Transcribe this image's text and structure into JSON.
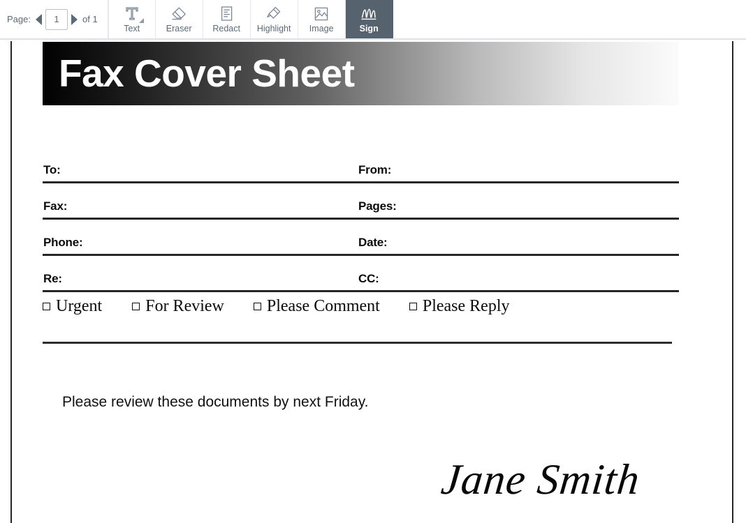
{
  "toolbar": {
    "page_nav": {
      "label": "Page:",
      "prev_icon": "triangle-left-icon",
      "current_page": "1",
      "next_icon": "triangle-right-icon",
      "total_label": "of 1"
    },
    "tools": [
      {
        "id": "text",
        "label": "Text",
        "icon": "text-tool-icon",
        "active": false,
        "has_dropdown": true
      },
      {
        "id": "eraser",
        "label": "Eraser",
        "icon": "eraser-icon",
        "active": false,
        "has_dropdown": false
      },
      {
        "id": "redact",
        "label": "Redact",
        "icon": "redact-document-icon",
        "active": false,
        "has_dropdown": false
      },
      {
        "id": "highlight",
        "label": "Highlight",
        "icon": "highlighter-pen-icon",
        "active": false,
        "has_dropdown": false
      },
      {
        "id": "image",
        "label": "Image",
        "icon": "image-picture-icon",
        "active": false,
        "has_dropdown": false
      },
      {
        "id": "sign",
        "label": "Sign",
        "icon": "signature-icon",
        "active": true,
        "has_dropdown": false
      }
    ],
    "colors": {
      "active_background": "#56636f",
      "active_text": "#ffffff",
      "icon": "#7b8894",
      "text": "#5b6a78",
      "border": "#e4e8ec"
    }
  },
  "document": {
    "title": "Fax Cover Sheet",
    "banner_gradient": {
      "from": "#010101",
      "to": "#fbfbfb"
    },
    "fields": [
      {
        "left_label": "To:",
        "left_value": "",
        "right_label": "From:",
        "right_value": ""
      },
      {
        "left_label": "Fax:",
        "left_value": "",
        "right_label": "Pages:",
        "right_value": ""
      },
      {
        "left_label": "Phone:",
        "left_value": "",
        "right_label": "Date:",
        "right_value": ""
      },
      {
        "left_label": "Re:",
        "left_value": "",
        "right_label": "CC:",
        "right_value": ""
      }
    ],
    "checkboxes": [
      {
        "label": "Urgent",
        "checked": false
      },
      {
        "label": "For Review",
        "checked": false
      },
      {
        "label": "Please Comment",
        "checked": false
      },
      {
        "label": "Please Reply",
        "checked": false
      }
    ],
    "message": "Please review these documents by next Friday.",
    "signature": "Jane Smith"
  }
}
